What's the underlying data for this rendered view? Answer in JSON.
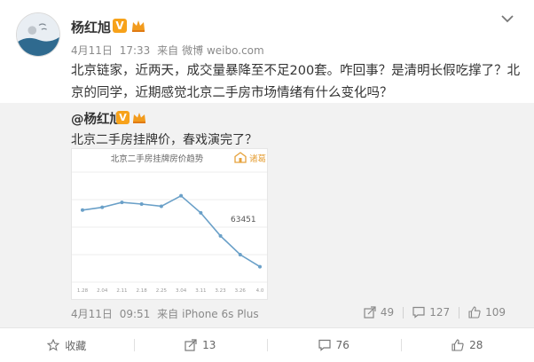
{
  "post": {
    "author": "杨红旭",
    "verified_badge": "V",
    "verified_color": "#f7a21a",
    "crown_color": "#f29b1d",
    "date": "4月11日",
    "time": "17:33",
    "source_prefix": "来自",
    "source": "微博 weibo.com",
    "text": "北京链家，近两天，成交量暴降至不足200套。咋回事？是清明长假吃撑了？北京的同学，近期感觉北京二手房市场情绪有什么变化吗？"
  },
  "repost": {
    "author": "@杨红旭",
    "verified_badge": "V",
    "text": "北京二手房挂牌价，春戏演完了？",
    "date": "4月11日",
    "time": "09:51",
    "source_prefix": "来自",
    "source": "iPhone 6s Plus",
    "actions": {
      "share_count": "49",
      "comment_count": "127",
      "like_count": "109"
    }
  },
  "chart_data": {
    "type": "line",
    "title": "北京二手房挂牌房价趋势",
    "brand": "诸葛",
    "annotation": "63451",
    "x": [
      "1.28",
      "2.04",
      "2.11",
      "2.18",
      "2.25",
      "3.04",
      "3.11",
      "3.23",
      "3.26",
      "4.0"
    ],
    "series": [
      {
        "values": [
          64420,
          64520,
          64700,
          64640,
          64560,
          64940,
          64320,
          63480,
          62800,
          62360
        ],
        "color": "#6aa0c8"
      }
    ],
    "ylim": [
      61800,
      65800
    ],
    "grid": true
  },
  "footer": {
    "favorite_label": "收藏",
    "repost_count": "13",
    "comment_count": "76",
    "like_count": "28"
  }
}
